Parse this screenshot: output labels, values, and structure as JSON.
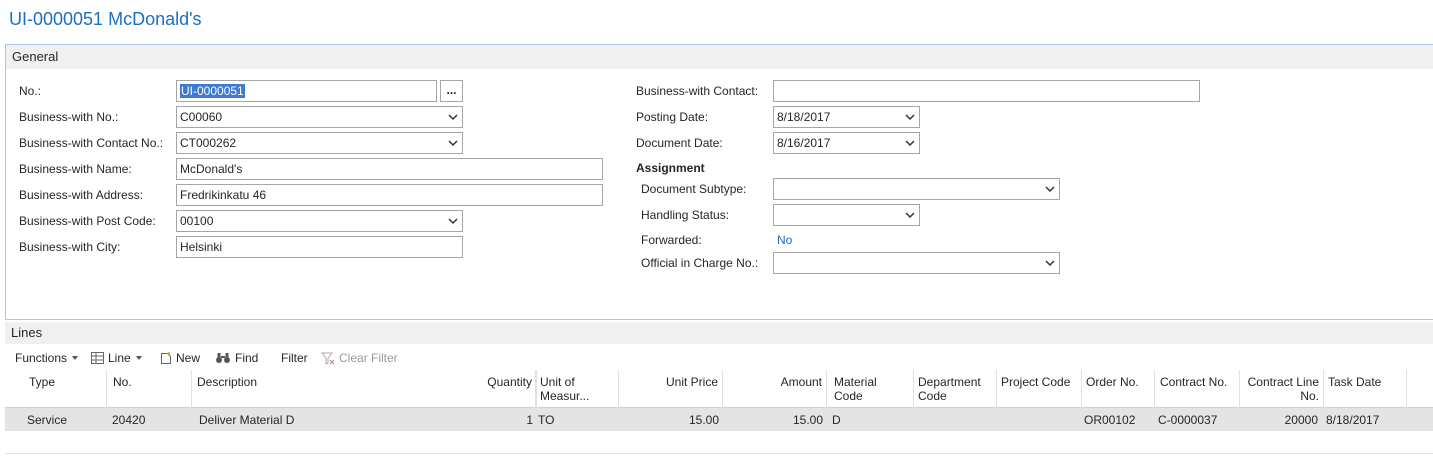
{
  "page": {
    "title": "UI-0000051 McDonald's"
  },
  "general": {
    "header": "General",
    "no_label": "No.:",
    "no_value": "UI-0000051",
    "assist_label": "...",
    "business_no_label": "Business-with No.:",
    "business_no_value": "C00060",
    "contact_no_label": "Business-with Contact No.:",
    "contact_no_value": "CT000262",
    "name_label": "Business-with Name:",
    "name_value": "McDonald's",
    "address_label": "Business-with Address:",
    "address_value": "Fredrikinkatu 46",
    "post_code_label": "Business-with Post Code:",
    "post_code_value": "00100",
    "city_label": "Business-with City:",
    "city_value": "Helsinki",
    "contact_label": "Business-with Contact:",
    "contact_value": "",
    "posting_date_label": "Posting Date:",
    "posting_date_value": "8/18/2017",
    "document_date_label": "Document Date:",
    "document_date_value": "8/16/2017",
    "assignment_label": "Assignment",
    "doc_subtype_label": "Document Subtype:",
    "doc_subtype_value": "",
    "handling_status_label": "Handling Status:",
    "handling_status_value": "",
    "forwarded_label": "Forwarded:",
    "forwarded_value": "No",
    "official_label": "Official in Charge No.:",
    "official_value": ""
  },
  "lines": {
    "header": "Lines",
    "toolbar": {
      "functions": "Functions",
      "line": "Line",
      "new": "New",
      "find": "Find",
      "filter": "Filter",
      "clear_filter": "Clear Filter"
    },
    "columns": {
      "type": "Type",
      "no": "No.",
      "description": "Description",
      "quantity": "Quantity",
      "unit_1": "Unit of",
      "unit_2": "Measur...",
      "unit_price": "Unit Price",
      "amount": "Amount",
      "material_1": "Material",
      "material_2": "Code",
      "department_1": "Department",
      "department_2": "Code",
      "project": "Project Code",
      "order": "Order No.",
      "contract": "Contract No.",
      "contract_line_1": "Contract Line",
      "contract_line_2": "No.",
      "task_date": "Task Date"
    },
    "rows": [
      {
        "type": "Service",
        "no": "20420",
        "description": "Deliver Material D",
        "quantity": "1",
        "unit": "TO",
        "unit_price": "15.00",
        "amount": "15.00",
        "material": "D",
        "department": "",
        "project": "",
        "order": "OR00102",
        "contract": "C-0000037",
        "contract_line": "20000",
        "task_date": "8/18/2017"
      }
    ]
  }
}
